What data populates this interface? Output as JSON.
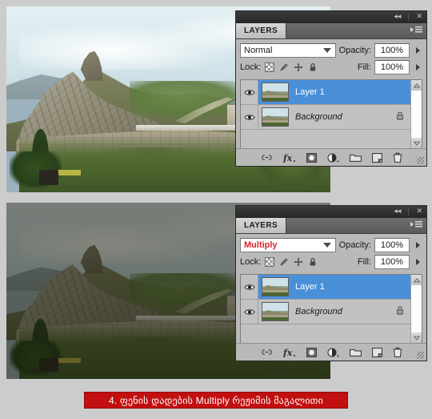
{
  "figures": [
    {
      "id": "figure-top",
      "alt": "Narikala fortress and church photograph, normal blend mode",
      "state": "normal"
    },
    {
      "id": "figure-bottom",
      "alt": "Narikala fortress and church photograph, darkened by Multiply blend mode",
      "state": "multiply"
    }
  ],
  "panels": [
    {
      "titlebar": {
        "collapse": "◂◂",
        "close": "✕"
      },
      "tab_label": "LAYERS",
      "menu_icon": "panel-menu-icon",
      "blend_mode": "Normal",
      "blend_mode_accent": false,
      "opacity_label": "Opacity:",
      "opacity_value": "100%",
      "lock_label": "Lock:",
      "lock_icons": [
        "transparency-lock-icon",
        "paint-lock-icon",
        "move-lock-icon",
        "all-lock-icon"
      ],
      "fill_label": "Fill:",
      "fill_value": "100%",
      "layers": [
        {
          "name": "Layer 1",
          "selected": true,
          "visible": true,
          "locked": false
        },
        {
          "name": "Background",
          "selected": false,
          "visible": true,
          "locked": true
        }
      ],
      "footer_icons": [
        "link-layers-icon",
        "layer-style-fx-icon",
        "layer-mask-icon",
        "adjustment-layer-icon",
        "new-group-icon",
        "new-layer-icon",
        "delete-layer-icon"
      ]
    },
    {
      "titlebar": {
        "collapse": "◂◂",
        "close": "✕"
      },
      "tab_label": "LAYERS",
      "menu_icon": "panel-menu-icon",
      "blend_mode": "Multiply",
      "blend_mode_accent": true,
      "opacity_label": "Opacity:",
      "opacity_value": "100%",
      "lock_label": "Lock:",
      "lock_icons": [
        "transparency-lock-icon",
        "paint-lock-icon",
        "move-lock-icon",
        "all-lock-icon"
      ],
      "fill_label": "Fill:",
      "fill_value": "100%",
      "layers": [
        {
          "name": "Layer 1",
          "selected": true,
          "visible": true,
          "locked": false
        },
        {
          "name": "Background",
          "selected": false,
          "visible": true,
          "locked": true
        }
      ],
      "footer_icons": [
        "link-layers-icon",
        "layer-style-fx-icon",
        "layer-mask-icon",
        "adjustment-layer-icon",
        "new-group-icon",
        "new-layer-icon",
        "delete-layer-icon"
      ]
    }
  ],
  "caption": {
    "text": "4. ფენის  დადების Multiply რეჟიმის  მაგალითი"
  },
  "colors": {
    "page_background": "#cccccc",
    "caption_background": "#c20f0f",
    "caption_text": "#ffffff",
    "accent_blend_mode": "#d8232a",
    "selected_layer": "#4a90d9",
    "panel_background": "#b9b9b9",
    "panel_titlebar": "#282828"
  }
}
